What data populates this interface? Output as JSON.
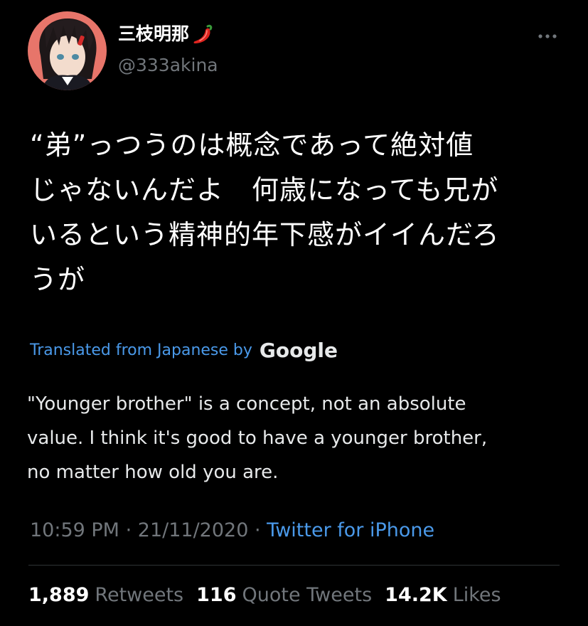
{
  "header": {
    "display_name": "三枝明那",
    "name_emoji": "pepper-icon",
    "handle": "@333akina",
    "more_icon": "more-dots-icon"
  },
  "tweet": {
    "lines": [
      "“弟”っつうのは概念であって絶対値",
      "じゃないんだよ　何歳になっても兄が",
      "いるという精神的年下感がイイんだろ",
      "うが"
    ]
  },
  "translation": {
    "label": "Translated from Japanese by",
    "provider": "Google",
    "lines": [
      "\"Younger brother\" is a concept, not an absolute",
      "value. I think it's good to have a younger brother,",
      "no matter how old you are."
    ]
  },
  "meta": {
    "time": "10:59 PM",
    "separator": "·",
    "date": "21/11/2020",
    "source": "Twitter for iPhone"
  },
  "stats": {
    "retweets_count": "1,889",
    "retweets_label": "Retweets",
    "quotes_count": "116",
    "quotes_label": "Quote Tweets",
    "likes_count": "14.2K",
    "likes_label": "Likes"
  },
  "colors": {
    "background": "#000000",
    "text": "#ffffff",
    "secondary": "#71767b",
    "link": "#4a99e9",
    "divider": "#2f3336"
  }
}
